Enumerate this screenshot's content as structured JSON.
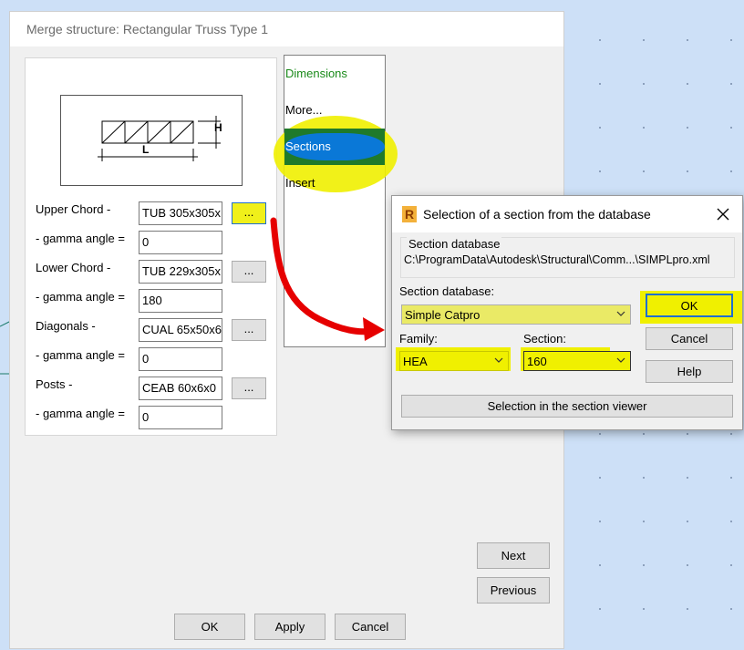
{
  "main_dialog": {
    "title": "Merge structure: Rectangular Truss Type 1",
    "diagram": {
      "height_label": "H",
      "length_label": "L"
    },
    "fields": [
      {
        "label": "Upper Chord -",
        "value": "TUB 305x305x",
        "browse": "..."
      },
      {
        "label": "- gamma angle =",
        "value": "0"
      },
      {
        "label": "Lower Chord -",
        "value": "TUB 229x305x",
        "browse": "..."
      },
      {
        "label": "- gamma angle =",
        "value": "180"
      },
      {
        "label": "Diagonals -",
        "value": "CUAL 65x50x6",
        "browse": "..."
      },
      {
        "label": "- gamma angle =",
        "value": "0"
      },
      {
        "label": "Posts -",
        "value": "CEAB 60x6x0",
        "browse": "..."
      },
      {
        "label": "- gamma angle =",
        "value": "0"
      }
    ],
    "menu": {
      "items": [
        "Dimensions",
        "More...",
        "Sections",
        "Insert"
      ],
      "selected": "Sections",
      "dimensions_color": "#1a8a1a",
      "selected_color": "#0a78d7"
    },
    "next_label": "Next",
    "previous_label": "Previous",
    "ok_label": "OK",
    "apply_label": "Apply",
    "cancel_label": "Cancel"
  },
  "popup": {
    "title": "Selection of a section from the database",
    "app_icon": "revit-r-icon",
    "groupbox_label": "Section database",
    "db_path": "C:\\ProgramData\\Autodesk\\Structural\\Comm...\\SIMPLpro.xml",
    "section_db_label": "Section database:",
    "section_db_value": "Simple Catpro",
    "family_label": "Family:",
    "family_value": "HEA",
    "section_label": "Section:",
    "section_value": "160",
    "ok_label": "OK",
    "cancel_label": "Cancel",
    "help_label": "Help",
    "viewer_button": "Selection in the section viewer"
  },
  "annotations": {
    "highlight_color": "#f0f000",
    "arrow_color": "#e60000"
  }
}
